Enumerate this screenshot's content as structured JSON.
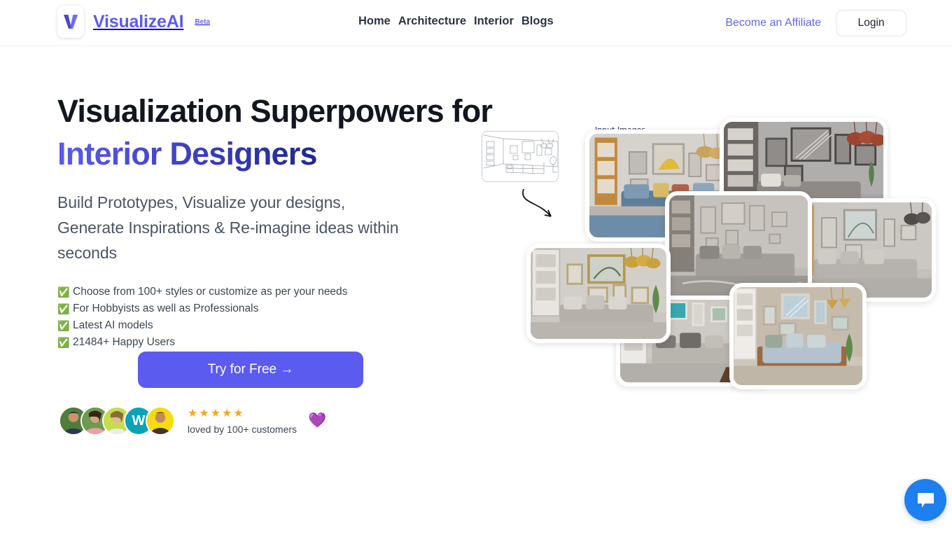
{
  "header": {
    "brand": {
      "name": "VisualizeAI",
      "beta": "Beta",
      "logo_icon": "v-logo-icon"
    },
    "nav": [
      {
        "label": "Home"
      },
      {
        "label": "Architecture"
      },
      {
        "label": "Interior"
      },
      {
        "label": "Blogs"
      }
    ],
    "affiliate_label": "Become an Affiliate",
    "login_label": "Login"
  },
  "hero": {
    "headline_line1": "Visualization Superpowers for",
    "headline_line2": "Interior Designers",
    "subhead": "Build Prototypes, Visualize your designs, Generate Inspirations & Re-imagine ideas within seconds",
    "features": [
      {
        "check": "✅",
        "text": "Choose from 100+ styles or customize as per your needs"
      },
      {
        "check": "✅",
        "text": "For Hobbyists as well as Professionals"
      },
      {
        "check": "✅",
        "text": "Latest AI models"
      },
      {
        "check": "✅",
        "text": "21484+ Happy Users"
      }
    ],
    "cta_label": "Try for Free  →",
    "social_proof": {
      "stars": "★★★★★",
      "caption": "loved by 100+ customers",
      "heart": "💜",
      "avatars": [
        {
          "name": "avatar-user-1",
          "bg": "#4d7a3a",
          "initial": ""
        },
        {
          "name": "avatar-user-2",
          "bg": "#5f8a4b",
          "initial": ""
        },
        {
          "name": "avatar-user-3",
          "bg": "#c2d84a",
          "initial": ""
        },
        {
          "name": "avatar-user-4",
          "bg": "#0aa3b5",
          "initial": "W"
        },
        {
          "name": "avatar-user-5",
          "bg": "#f2d60a",
          "initial": ""
        }
      ]
    }
  },
  "showcase": {
    "input_label": "Input Images",
    "sketch_alt": "living-room-line-sketch",
    "images": [
      {
        "alt": "generated-interior-1"
      },
      {
        "alt": "generated-interior-2"
      },
      {
        "alt": "generated-interior-3"
      },
      {
        "alt": "generated-interior-4"
      },
      {
        "alt": "generated-interior-5"
      },
      {
        "alt": "generated-interior-6"
      }
    ]
  },
  "chat_widget": {
    "icon": "chat-bubble-icon",
    "color": "#1e7fef"
  }
}
